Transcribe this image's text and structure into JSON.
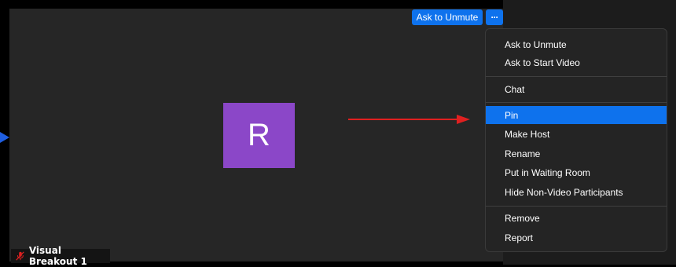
{
  "video": {
    "avatar_letter": "R",
    "participant_name": "Visual Breakout 1",
    "ask_to_unmute_label": "Ask to Unmute",
    "more_label": "···"
  },
  "menu": {
    "items": [
      {
        "label": "Ask to Unmute"
      },
      {
        "label": "Ask to Start Video"
      },
      {
        "label": "Chat"
      },
      {
        "label": "Pin"
      },
      {
        "label": "Make Host"
      },
      {
        "label": "Rename"
      },
      {
        "label": "Put in Waiting Room"
      },
      {
        "label": "Hide Non-Video Participants"
      },
      {
        "label": "Remove"
      },
      {
        "label": "Report"
      }
    ],
    "active_item": "Pin"
  },
  "colors": {
    "accent": "#0e72ed",
    "avatar": "#8b47c8",
    "annotation_arrow": "#e02020"
  },
  "icons": {
    "mic": "muted-mic-icon",
    "more": "ellipsis-icon"
  }
}
